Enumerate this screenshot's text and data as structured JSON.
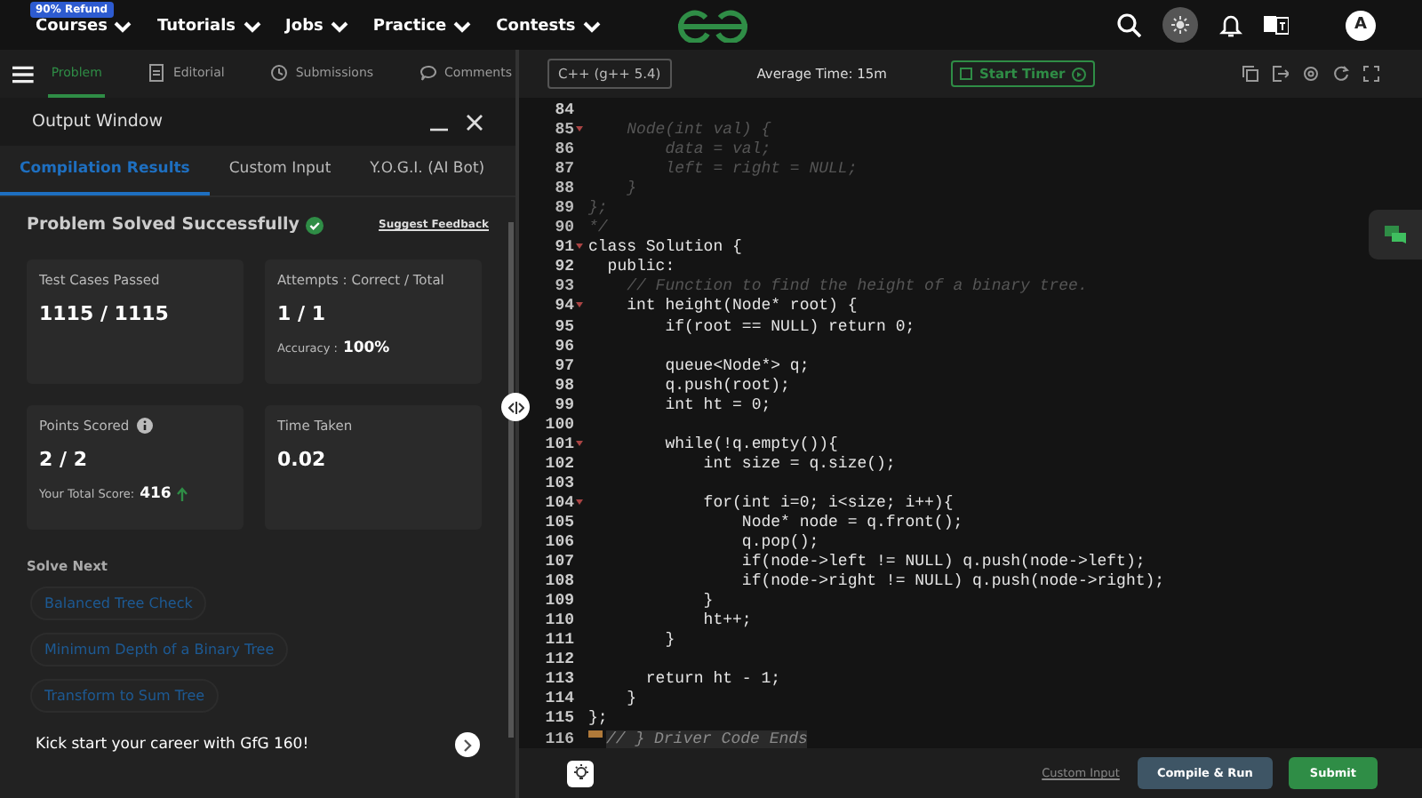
{
  "top_nav": {
    "badge": "90% Refund",
    "menus": [
      {
        "label": "Courses"
      },
      {
        "label": "Tutorials"
      },
      {
        "label": "Jobs"
      },
      {
        "label": "Practice"
      },
      {
        "label": "Contests"
      }
    ],
    "avatar": "A"
  },
  "problem_tabs": [
    {
      "label": "Problem",
      "selected": true
    },
    {
      "label": "Editorial",
      "selected": false
    },
    {
      "label": "Submissions",
      "selected": false
    },
    {
      "label": "Comments",
      "selected": false
    }
  ],
  "editor_toolbar": {
    "language": "C++ (g++ 5.4)",
    "average_time": "Average Time: 15m",
    "timer_button": "Start Timer"
  },
  "output_window": {
    "title": "Output Window",
    "tabs": [
      {
        "label": "Compilation Results",
        "selected": true
      },
      {
        "label": "Custom Input",
        "selected": false
      },
      {
        "label": "Y.O.G.I. (AI Bot)",
        "selected": false
      }
    ],
    "status": "Problem Solved Successfully",
    "feedback_link": "Suggest Feedback",
    "cards": [
      {
        "label": "Test Cases Passed",
        "value": "1115 / 1115"
      },
      {
        "label": "Attempts : Correct / Total",
        "value": "1 / 1",
        "detail_label": "Accuracy :",
        "detail_value": "100%"
      },
      {
        "label": "Points Scored",
        "info": true,
        "value": "2 / 2",
        "detail_label": "Your Total Score:",
        "detail_value": "416",
        "rising": true
      },
      {
        "label": "Time Taken",
        "value": "0.02"
      }
    ],
    "solve_next_title": "Solve Next",
    "suggestions": [
      {
        "label": "Balanced Tree Check"
      },
      {
        "label": "Minimum Depth of a Binary Tree"
      },
      {
        "label": "Transform to Sum Tree"
      }
    ],
    "promo": "Kick start your career with GfG 160!"
  },
  "code": [
    {
      "number": "84",
      "kind": "code",
      "foldable": false
    },
    {
      "number": "85",
      "text": "    Node(int val) {",
      "kind": "comment",
      "foldable": true
    },
    {
      "number": "86",
      "text": "        data = val;",
      "kind": "comment",
      "foldable": false
    },
    {
      "number": "87",
      "text": "        left = right = NULL;",
      "kind": "comment",
      "foldable": false
    },
    {
      "number": "88",
      "text": "    }",
      "kind": "comment",
      "foldable": false
    },
    {
      "number": "89",
      "text": "};",
      "kind": "comment",
      "foldable": false
    },
    {
      "number": "90",
      "text": "*/",
      "kind": "comment",
      "foldable": false
    },
    {
      "number": "91",
      "text": "class Solution {",
      "kind": "code",
      "foldable": true
    },
    {
      "number": "92",
      "text": "  public:",
      "kind": "code",
      "foldable": false
    },
    {
      "number": "93",
      "text": "    // Function to find the height of a binary tree.",
      "kind": "comment",
      "foldable": false
    },
    {
      "number": "94",
      "text": "    int height(Node* root) {",
      "kind": "code",
      "foldable": true
    },
    {
      "number": "95",
      "text": "        if(root == NULL) return 0;",
      "kind": "code",
      "foldable": false
    },
    {
      "number": "96",
      "kind": "code",
      "foldable": false
    },
    {
      "number": "97",
      "text": "        queue<Node*> q;",
      "kind": "code",
      "foldable": false
    },
    {
      "number": "98",
      "text": "        q.push(root);",
      "kind": "code",
      "foldable": false
    },
    {
      "number": "99",
      "text": "        int ht = 0;",
      "kind": "code",
      "foldable": false
    },
    {
      "number": "100",
      "kind": "code",
      "foldable": false
    },
    {
      "number": "101",
      "text": "        while(!q.empty()){",
      "kind": "code",
      "foldable": true
    },
    {
      "number": "102",
      "text": "            int size = q.size();",
      "kind": "code",
      "foldable": false
    },
    {
      "number": "103",
      "kind": "code",
      "foldable": false
    },
    {
      "number": "104",
      "text": "            for(int i=0; i<size; i++){",
      "kind": "code",
      "foldable": true
    },
    {
      "number": "105",
      "text": "                Node* node = q.front();",
      "kind": "code",
      "foldable": false
    },
    {
      "number": "106",
      "text": "                q.pop();",
      "kind": "code",
      "foldable": false
    },
    {
      "number": "107",
      "text": "                if(node->left != NULL) q.push(node->left);",
      "kind": "code",
      "foldable": false
    },
    {
      "number": "108",
      "text": "                if(node->right != NULL) q.push(node->right);",
      "kind": "code",
      "foldable": false
    },
    {
      "number": "109",
      "text": "            }",
      "kind": "code",
      "foldable": false
    },
    {
      "number": "110",
      "text": "            ht++;",
      "kind": "code",
      "foldable": false
    },
    {
      "number": "111",
      "text": "        }",
      "kind": "code",
      "foldable": false
    },
    {
      "number": "112",
      "kind": "code",
      "foldable": false
    },
    {
      "number": "113",
      "text": "      return ht - 1;",
      "kind": "code",
      "foldable": false
    },
    {
      "number": "114",
      "text": "    }",
      "kind": "code",
      "foldable": false
    },
    {
      "number": "115",
      "text": "};",
      "kind": "code",
      "foldable": false
    },
    {
      "number": "116",
      "text": "// } Driver Code Ends",
      "kind": "folded",
      "foldable": false
    }
  ],
  "footer": {
    "custom_input": "Custom Input",
    "compile_button": "Compile & Run",
    "submit_button": "Submit"
  }
}
